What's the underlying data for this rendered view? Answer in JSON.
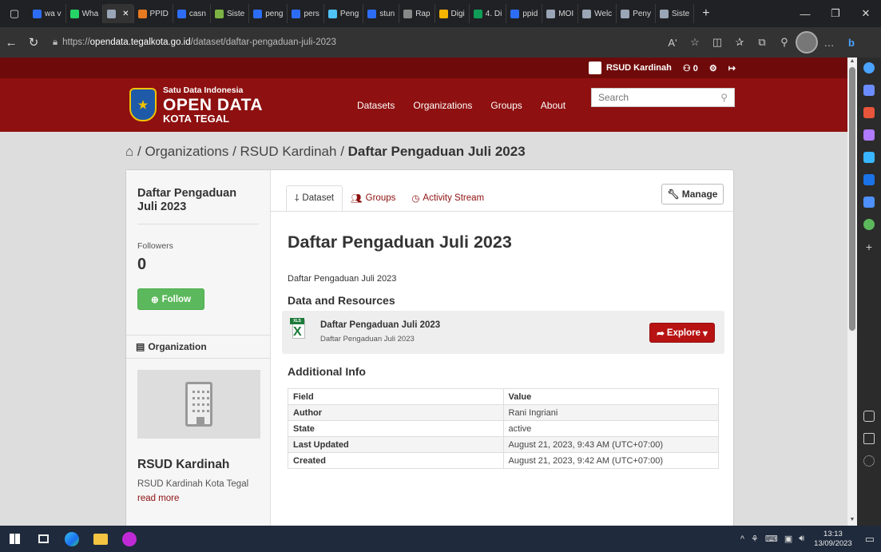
{
  "browser": {
    "tabs": [
      {
        "label": "wa v",
        "color": "#2d6df6"
      },
      {
        "label": "Wha",
        "color": "#25d366"
      },
      {
        "label": "",
        "color": "#9aa5b6",
        "active": true,
        "close": "✕"
      },
      {
        "label": "PPID",
        "color": "#e87a20"
      },
      {
        "label": "casn",
        "color": "#2d6df6"
      },
      {
        "label": "Siste",
        "color": "#7cb342"
      },
      {
        "label": "peng",
        "color": "#2d6df6"
      },
      {
        "label": "pers",
        "color": "#2d6df6"
      },
      {
        "label": "Peng",
        "color": "#4fc3f7"
      },
      {
        "label": "stun",
        "color": "#2d6df6"
      },
      {
        "label": "Rap",
        "color": "#888888"
      },
      {
        "label": "Digi",
        "color": "#f4b400"
      },
      {
        "label": "4. Di",
        "color": "#0f9d58"
      },
      {
        "label": "ppid",
        "color": "#2d6df6"
      },
      {
        "label": "MOI",
        "color": "#9aa5b6"
      },
      {
        "label": "Welc",
        "color": "#9aa5b6"
      },
      {
        "label": "Peny",
        "color": "#9aa5b6"
      },
      {
        "label": "Siste",
        "color": "#9aa5b6"
      }
    ],
    "new_tab": "+",
    "url_prefix": "https://",
    "url_host": "opendata.tegalkota.go.id",
    "url_path": "/dataset/daftar-pengaduan-juli-2023",
    "read_aloud": "Aʹ"
  },
  "site": {
    "account_name": "RSUD Kardinah",
    "notifications": "0",
    "logo_line1": "Satu Data Indonesia",
    "logo_line2": "OPEN DATA",
    "logo_line3": "KOTA TEGAL",
    "nav": [
      "Datasets",
      "Organizations",
      "Groups",
      "About"
    ],
    "search_placeholder": "Search"
  },
  "breadcrumb": {
    "home_icon": "home-icon",
    "sep": " / ",
    "items": [
      "Organizations",
      "RSUD Kardinah"
    ],
    "current": "Daftar Pengaduan Juli 2023"
  },
  "sidebar": {
    "title": "Daftar Pengaduan Juli 2023",
    "followers_label": "Followers",
    "followers_count": "0",
    "follow_label": "Follow",
    "org_section": "Organization",
    "org_name": "RSUD Kardinah",
    "org_desc": "RSUD Kardinah Kota Tegal",
    "read_more": "read more"
  },
  "page": {
    "tabs": [
      "Dataset",
      "Groups",
      "Activity Stream"
    ],
    "manage_label": "Manage",
    "title": "Daftar Pengaduan Juli 2023",
    "description": "Daftar Pengaduan Juli 2023",
    "resources_heading": "Data and Resources",
    "resource": {
      "format": "XLS",
      "name": "Daftar Pengaduan Juli 2023",
      "desc": "Daftar Pengaduan Juli 2023",
      "explore_label": "Explore"
    },
    "additional_heading": "Additional Info",
    "table": {
      "headers": [
        "Field",
        "Value"
      ],
      "rows": [
        [
          "Author",
          "Rani Ingriani"
        ],
        [
          "State",
          "active"
        ],
        [
          "Last Updated",
          "August 21, 2023, 9:43 AM (UTC+07:00)"
        ],
        [
          "Created",
          "August 21, 2023, 9:42 AM (UTC+07:00)"
        ]
      ]
    }
  },
  "taskbar": {
    "time": "13:13",
    "date": "13/09/2023"
  },
  "colors": {
    "brand_dark": "#6f0a0a",
    "brand": "#8e1010",
    "follow_green": "#5cb85c",
    "explore_red": "#b71313"
  }
}
